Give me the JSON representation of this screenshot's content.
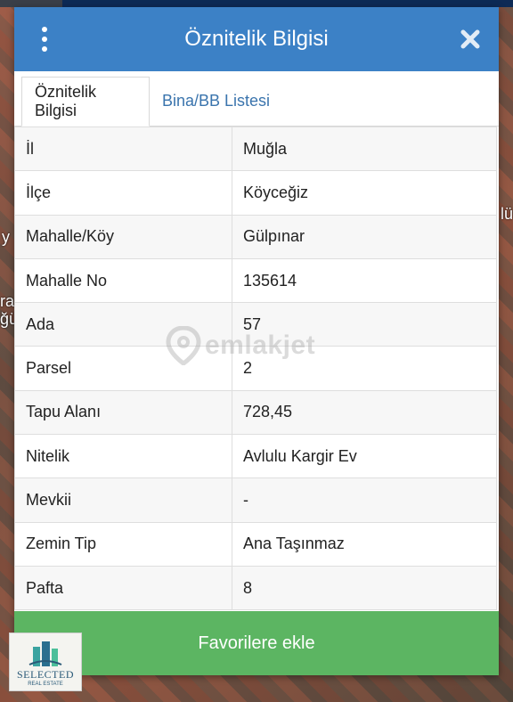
{
  "map": {
    "edge_texts": [
      "y",
      "ra",
      "ğü",
      "lü"
    ]
  },
  "dialog": {
    "title": "Öznitelik Bilgisi",
    "tabs": [
      {
        "label": "Öznitelik Bilgisi",
        "active": true
      },
      {
        "label": "Bina/BB Listesi",
        "active": false
      }
    ],
    "rows": [
      {
        "key": "İl",
        "value": "Muğla"
      },
      {
        "key": "İlçe",
        "value": "Köyceğiz"
      },
      {
        "key": "Mahalle/Köy",
        "value": "Gülpınar"
      },
      {
        "key": "Mahalle No",
        "value": "135614"
      },
      {
        "key": "Ada",
        "value": "57"
      },
      {
        "key": "Parsel",
        "value": "2"
      },
      {
        "key": "Tapu Alanı",
        "value": "728,45"
      },
      {
        "key": "Nitelik",
        "value": "Avlulu Kargir Ev"
      },
      {
        "key": "Mevkii",
        "value": "-"
      },
      {
        "key": "Zemin Tip",
        "value": "Ana Taşınmaz"
      },
      {
        "key": "Pafta",
        "value": "8"
      }
    ],
    "favorite_button": "Favorilere ekle"
  },
  "watermark": {
    "text": "emlakjet"
  },
  "logo": {
    "line1": "SELECTED",
    "line2": "REAL ESTATE"
  },
  "icons": {
    "menu": "more-vertical-icon",
    "close": "close-icon",
    "watermark": "location-pin-icon"
  },
  "colors": {
    "header": "#3c81c6",
    "button": "#5cb562",
    "tab_link": "#3a74ad"
  }
}
